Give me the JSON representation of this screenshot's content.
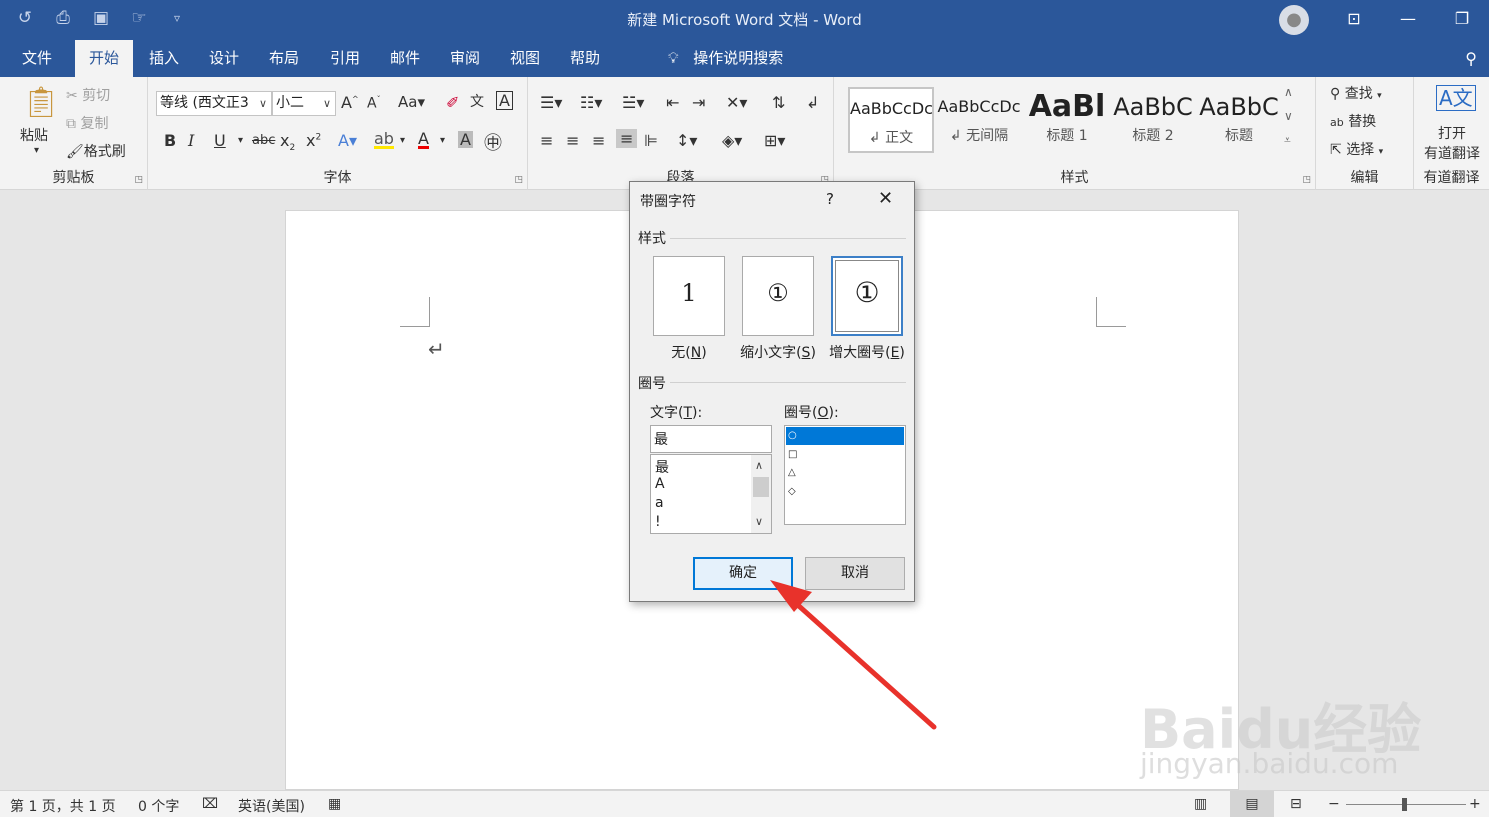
{
  "app": {
    "title": "新建 Microsoft Word 文档  -  Word"
  },
  "qat": {
    "icons": [
      "undo-icon",
      "print-preview-icon",
      "save-icon",
      "touch-mode-icon",
      "customize-qat-icon"
    ]
  },
  "menu": {
    "tabs": [
      "文件",
      "开始",
      "插入",
      "设计",
      "布局",
      "引用",
      "邮件",
      "审阅",
      "视图",
      "帮助"
    ],
    "tellme": "操作说明搜索"
  },
  "ribbon": {
    "clipboard": {
      "label": "剪贴板",
      "paste": "粘贴",
      "cut": "剪切",
      "copy": "复制",
      "format_painter": "格式刷"
    },
    "font": {
      "label": "字体",
      "font_name": "等线 (西文正3",
      "font_size": "小二"
    },
    "paragraph": {
      "label": "段落"
    },
    "styles": {
      "label": "样式",
      "items": [
        {
          "preview": "AaBbCcDc",
          "name": "↲ 正文"
        },
        {
          "preview": "AaBbCcDc",
          "name": "↲ 无间隔"
        },
        {
          "preview": "AaBl",
          "name": "标题 1"
        },
        {
          "preview": "AaBbC",
          "name": "标题 2"
        },
        {
          "preview": "AaBbC",
          "name": "标题"
        }
      ]
    },
    "editing": {
      "label": "编辑",
      "find": "查找",
      "replace": "替换",
      "select": "选择"
    },
    "youdao": {
      "label": "有道翻译",
      "open_line1": "打开",
      "open_line2": "有道翻译"
    }
  },
  "dialog": {
    "title": "带圈字符",
    "help": "?",
    "style_section": "样式",
    "styles": [
      {
        "glyph": "1",
        "label": "无(",
        "key": "N",
        "tail": ")"
      },
      {
        "glyph": "①",
        "label": "缩小文字(",
        "key": "S",
        "tail": ")"
      },
      {
        "glyph": "①",
        "label": "增大圈号(",
        "key": "E",
        "tail": ")"
      }
    ],
    "enclosure_section": "圈号",
    "text_label": "文字(",
    "text_key": "T",
    "text_tail": "):",
    "text_value": "最",
    "text_list": [
      "最",
      "A",
      "a",
      "!"
    ],
    "enclosure_label": "圈号(",
    "enclosure_key": "O",
    "enclosure_tail": "):",
    "enclosures": [
      "○",
      "□",
      "△",
      "◇"
    ],
    "ok": "确定",
    "cancel": "取消"
  },
  "status": {
    "page": "第 1 页，共 1 页",
    "words": "0 个字",
    "language": "英语(美国)",
    "zoom_minus": "−",
    "zoom_plus": "+"
  },
  "watermark": {
    "line1": "Baidu经验",
    "line2": "jingyan.baidu.com"
  },
  "colors": {
    "brand": "#2b579a",
    "selection": "#0078d7",
    "annotation_arrow": "#e8322b"
  }
}
